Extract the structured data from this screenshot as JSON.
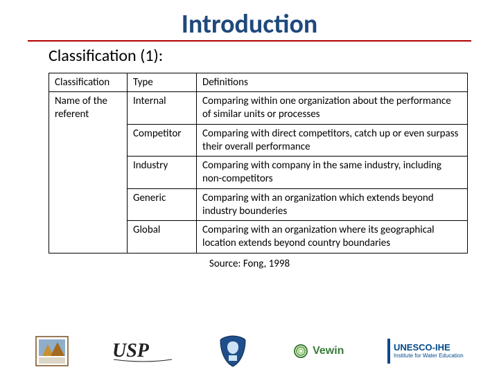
{
  "title": "Introduction",
  "subtitle": "Classification (1):",
  "table": {
    "header": {
      "classification": "Classification",
      "type": "Type",
      "definitions": "Definitions"
    },
    "group_label": "Name of the referent",
    "rows": [
      {
        "type": "Internal",
        "definition": "Comparing within one organization about the performance of similar units or processes"
      },
      {
        "type": "Competitor",
        "definition": "Comparing with direct competitors, catch up or even surpass their overall performance"
      },
      {
        "type": "Industry",
        "definition": "Comparing with company in the same industry, including non-competitors"
      },
      {
        "type": "Generic",
        "definition": "Comparing with an organization which extends beyond industry bounderies"
      },
      {
        "type": "Global",
        "definition": "Comparing with an organization where its geographical location extends beyond country boundaries"
      }
    ]
  },
  "source": "Source: Fong, 1998",
  "logos": {
    "org1": "affiliate-logo",
    "usp": "USP",
    "shield": "shield-crest",
    "vewin": "Vewin",
    "unesco_line1": "UNESCO-IHE",
    "unesco_line2": "Institute for Water Education"
  }
}
